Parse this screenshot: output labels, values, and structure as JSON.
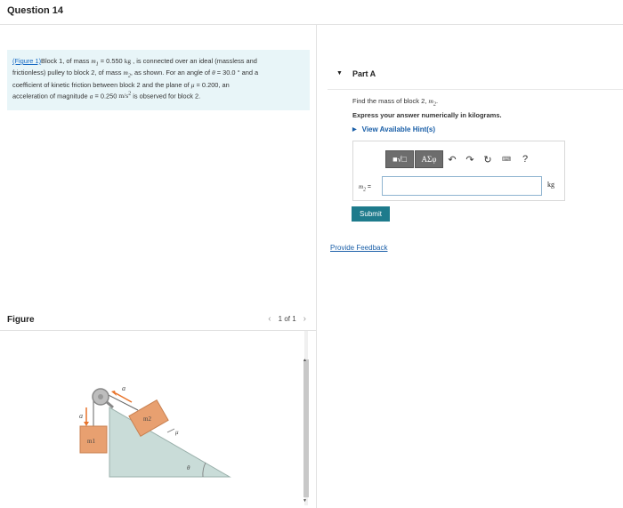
{
  "question": {
    "title": "Question 14"
  },
  "problem": {
    "figure_link": "(Figure 1)",
    "line1_a": "Block 1, of mass ",
    "m1_sym": "m",
    "m1_sub": "1",
    "line1_b": " = 0.550 ",
    "kg": "kg",
    "line1_c": " , is connected over an ideal (massless and",
    "line2_a": "frictionless) pulley to block 2, of mass ",
    "m2_sym": "m",
    "m2_sub": "2",
    "line2_b": ", as shown. For an angle of ",
    "theta": "θ",
    "line2_c": " = 30.0 ° and a",
    "line3_a": "coefficient of kinetic friction between block 2 and the plane of ",
    "mu": "μ",
    "line3_b": " = 0.200, an",
    "line4_a": "acceleration of magnitude ",
    "a_sym": "a",
    "line4_b": " = 0.250 ",
    "accel_unit": "m/s",
    "accel_exp": "2",
    "line4_c": " is observed for block 2."
  },
  "figure": {
    "title": "Figure",
    "pager": "1 of 1",
    "prev": "‹",
    "next": "›",
    "label_m1": "m1",
    "label_m2": "m2",
    "label_a": "a",
    "label_mu": "μ",
    "label_theta": "θ",
    "colors": {
      "block": "#e8a070",
      "ramp": "#c9dcd8",
      "arrow": "#e8732a"
    }
  },
  "part": {
    "caret": "▼",
    "title": "Part A",
    "prompt_a": "Find the mass of block 2, ",
    "prompt_sym": "m",
    "prompt_sub": "2",
    "prompt_b": ".",
    "instruction": "Express your answer numerically in kilograms.",
    "hint_caret": "▶",
    "hint": "View Available Hint(s)"
  },
  "answer": {
    "toolbar": {
      "templates": "■√□",
      "symbols": "ΑΣφ",
      "undo": "↶",
      "redo": "↷",
      "reset": "↻",
      "keyboard": "⌨",
      "help": "?"
    },
    "label_sym": "m",
    "label_sub": "2",
    "label_eq": " =",
    "value": "",
    "unit": "kg"
  },
  "submit_label": "Submit",
  "feedback_label": "Provide Feedback"
}
